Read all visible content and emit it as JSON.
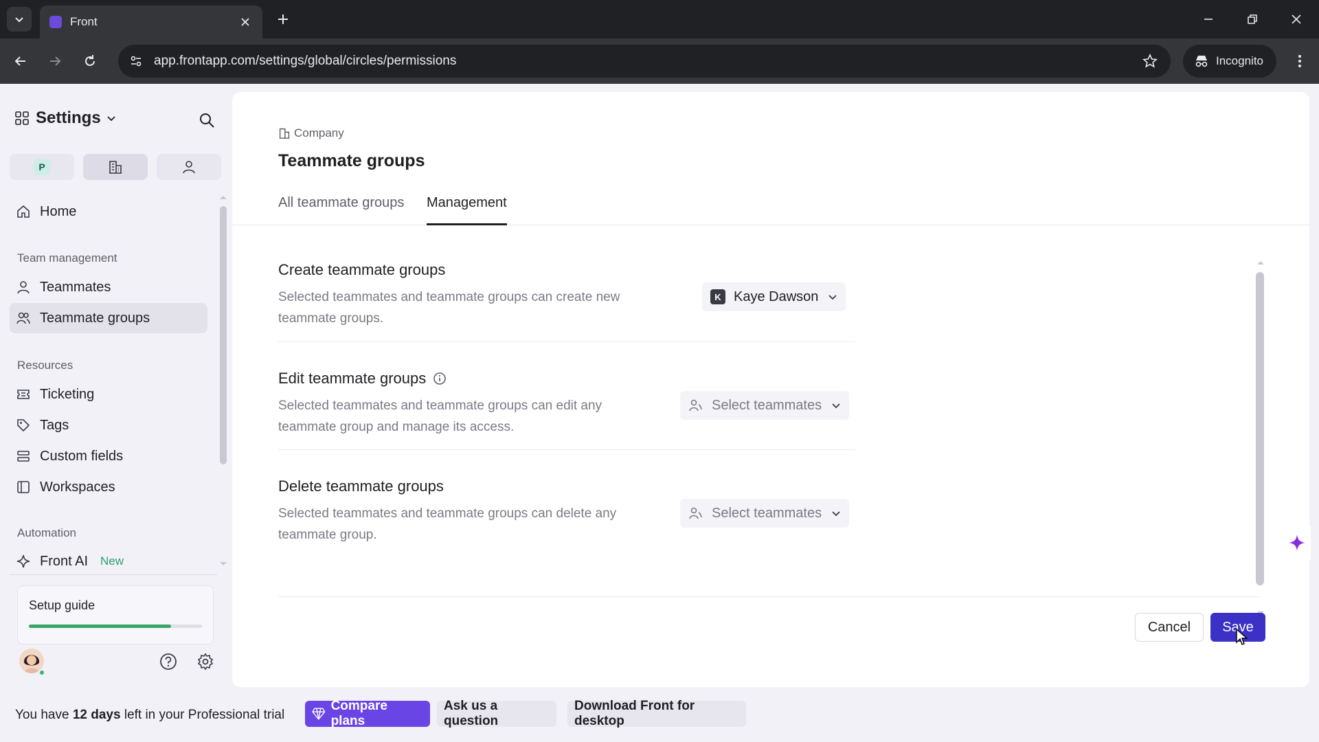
{
  "browser": {
    "tab_title": "Front",
    "url": "app.frontapp.com/settings/global/circles/permissions",
    "incognito_label": "Incognito"
  },
  "sidebar": {
    "title": "Settings",
    "scope_badge": "P",
    "home": "Home",
    "sections": {
      "team_management": "Team management",
      "resources": "Resources",
      "automation": "Automation"
    },
    "items": {
      "teammates": "Teammates",
      "teammate_groups": "Teammate groups",
      "ticketing": "Ticketing",
      "tags": "Tags",
      "custom_fields": "Custom fields",
      "workspaces": "Workspaces",
      "front_ai": "Front AI",
      "front_ai_badge": "New"
    },
    "setup_guide": {
      "label": "Setup guide",
      "progress": 0.82
    },
    "active_item": "teammate_groups"
  },
  "main": {
    "breadcrumb": "Company",
    "title": "Teammate groups",
    "tabs": [
      "All teammate groups",
      "Management"
    ],
    "active_tab": "Management",
    "permissions": [
      {
        "title": "Create teammate groups",
        "description": "Selected teammates and teammate groups can create new teammate groups.",
        "selection": {
          "initial": "K",
          "value": "Kaye Dawson"
        }
      },
      {
        "title": "Edit teammate groups",
        "description": "Selected teammates and teammate groups can edit any teammate group and manage its access.",
        "placeholder": "Select teammates"
      },
      {
        "title": "Delete teammate groups",
        "description": "Selected teammates and teammate groups can delete any teammate group.",
        "placeholder": "Select teammates"
      }
    ],
    "cancel_label": "Cancel",
    "save_label": "Save"
  },
  "banner": {
    "trial_prefix": "You have ",
    "trial_days": "12 days",
    "trial_suffix": " left in your Professional trial",
    "compare_plans": "Compare plans",
    "ask_question": "Ask us a question",
    "download": "Download Front for desktop"
  },
  "colors": {
    "accent": "#3c31c6",
    "compare_plans": "#6a45e6",
    "progress": "#3aa66b",
    "new_badge": "#2c9e6b"
  }
}
